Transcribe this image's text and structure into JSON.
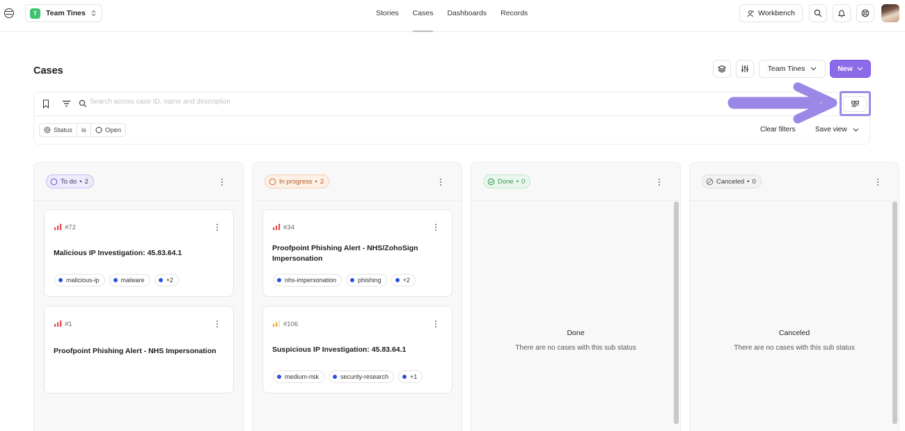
{
  "topbar": {
    "team_initial": "T",
    "team_name": "Team Tines",
    "nav": [
      "Stories",
      "Cases",
      "Dashboards",
      "Records"
    ],
    "active_nav": "Cases",
    "workbench_label": "Workbench"
  },
  "header": {
    "title": "Cases",
    "team_select": "Team Tines",
    "new_label": "New"
  },
  "filters": {
    "search_placeholder": "Search across case ID, name and description",
    "chip_field": "Status",
    "chip_op": "is",
    "chip_value": "Open",
    "clear_label": "Clear filters",
    "save_view_label": "Save view"
  },
  "columns": [
    {
      "status": "To do",
      "count": "2",
      "cards": [
        {
          "id": "#72",
          "priority": "high",
          "title": "Malicious IP Investigation: 45.83.64.1",
          "tags": [
            "malicious-ip",
            "malware"
          ],
          "more": "+2"
        },
        {
          "id": "#1",
          "priority": "high",
          "title": "Proofpoint Phishing Alert - NHS Impersonation",
          "tags": [],
          "more": ""
        }
      ]
    },
    {
      "status": "In progress",
      "count": "2",
      "cards": [
        {
          "id": "#34",
          "priority": "high",
          "title": "Proofpoint Phishing Alert - NHS/ZohoSign Impersonation",
          "tags": [
            "nhs-impersonation",
            "phishing"
          ],
          "more": "+2"
        },
        {
          "id": "#106",
          "priority": "medium",
          "title": "Suspicious IP Investigation: 45.83.64.1",
          "tags": [
            "medium-risk",
            "security-research"
          ],
          "more": "+1"
        }
      ]
    },
    {
      "status": "Done",
      "count": "0",
      "empty_title": "Done",
      "empty_sub": "There are no cases with this sub status"
    },
    {
      "status": "Canceled",
      "count": "0",
      "empty_title": "Canceled",
      "empty_sub": "There are no cases with this sub status"
    }
  ],
  "colors": {
    "accent": "#8c6be8",
    "highlight": "#9b87e6",
    "tag_dot": "#2b4fe0",
    "priority_high": "#e5484d",
    "priority_medium": "#f5a524"
  }
}
